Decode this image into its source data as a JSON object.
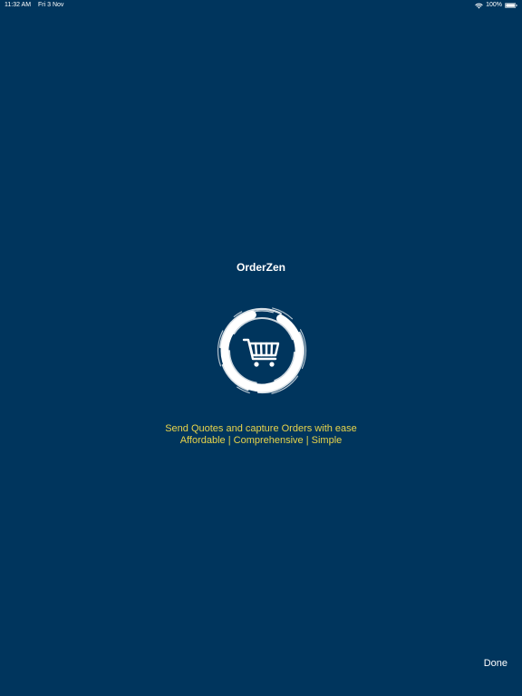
{
  "status_bar": {
    "time": "11:32 AM",
    "date": "Fri 3 Nov",
    "battery": "100%",
    "icons": [
      "wifi-icon",
      "battery-icon"
    ]
  },
  "app": {
    "title": "OrderZen",
    "logo_icon": "shopping-cart-icon"
  },
  "tagline": {
    "line1": "Send Quotes and capture Orders with ease",
    "line2": "Affordable | Comprehensive | Simple"
  },
  "actions": {
    "done_label": "Done"
  },
  "colors": {
    "background": "#00355d",
    "tagline": "#e8d44a",
    "text": "#ffffff"
  }
}
